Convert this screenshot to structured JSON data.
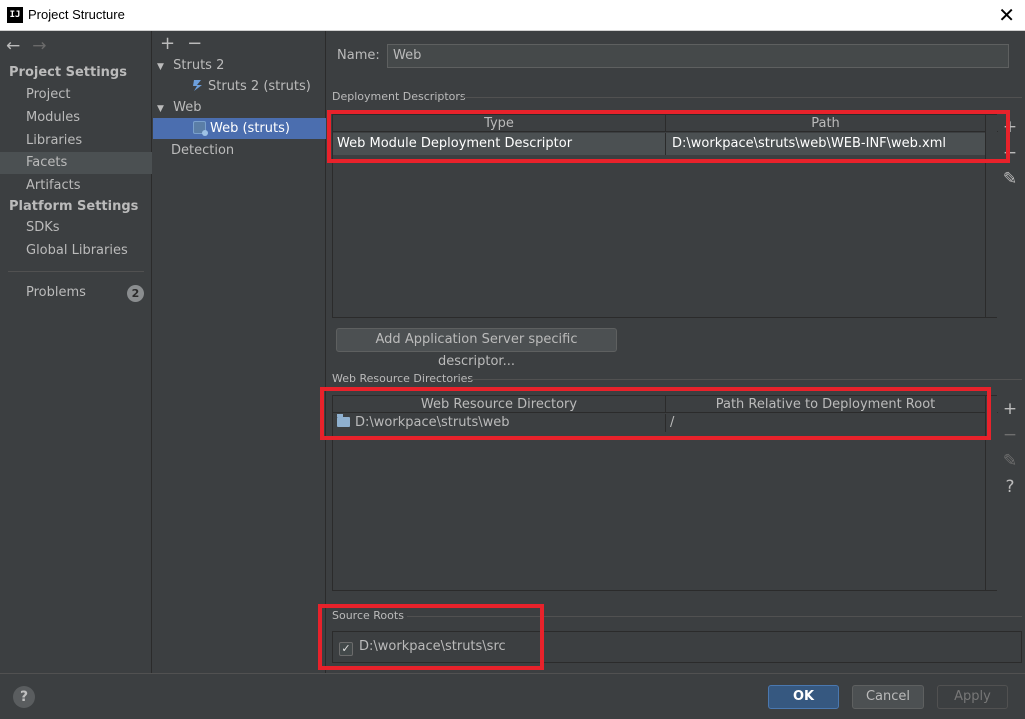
{
  "window": {
    "title": "Project Structure",
    "app_icon_label": "IJ"
  },
  "nav": {
    "back_arrow": "←",
    "forward_arrow": "→",
    "project_settings_header": "Project Settings",
    "project_settings_items": [
      "Project",
      "Modules",
      "Libraries",
      "Facets",
      "Artifacts"
    ],
    "selected_item": "Facets",
    "platform_settings_header": "Platform Settings",
    "platform_settings_items": [
      "SDKs",
      "Global Libraries"
    ],
    "problems_label": "Problems",
    "problems_count": "2"
  },
  "tree": {
    "add_symbol": "+",
    "remove_symbol": "−",
    "nodes": [
      {
        "label": "Struts 2",
        "type": "group"
      },
      {
        "label": "Struts 2 (struts)",
        "type": "facet"
      },
      {
        "label": "Web",
        "type": "group"
      },
      {
        "label": "Web (struts)",
        "type": "facet",
        "selected": true
      },
      {
        "label": "Detection",
        "type": "item"
      }
    ]
  },
  "facet": {
    "name_label": "Name:",
    "name_value": "Web",
    "deployment_descriptors": {
      "title": "Deployment Descriptors",
      "columns": [
        "Type",
        "Path"
      ],
      "rows": [
        {
          "type": "Web Module Deployment Descriptor",
          "path": "D:\\workpace\\struts\\web\\WEB-INF\\web.xml"
        }
      ],
      "add_server_button": "Add Application Server specific descriptor..."
    },
    "web_resource_directories": {
      "title": "Web Resource Directories",
      "columns": [
        "Web Resource Directory",
        "Path Relative to Deployment Root"
      ],
      "rows": [
        {
          "directory": "D:\\workpace\\struts\\web",
          "relative_path": "/"
        }
      ]
    },
    "source_roots": {
      "title": "Source Roots",
      "items": [
        {
          "path": "D:\\workpace\\struts\\src",
          "checked": true
        }
      ]
    }
  },
  "toolbar_icons": {
    "add": "+",
    "remove": "−",
    "edit": "✎",
    "help": "?"
  },
  "footer": {
    "help_symbol": "?",
    "ok_label": "OK",
    "cancel_label": "Cancel",
    "apply_label": "Apply"
  },
  "colors": {
    "accent": "#4b6eaf",
    "highlight": "#e8222b",
    "ok_button": "#365880"
  }
}
